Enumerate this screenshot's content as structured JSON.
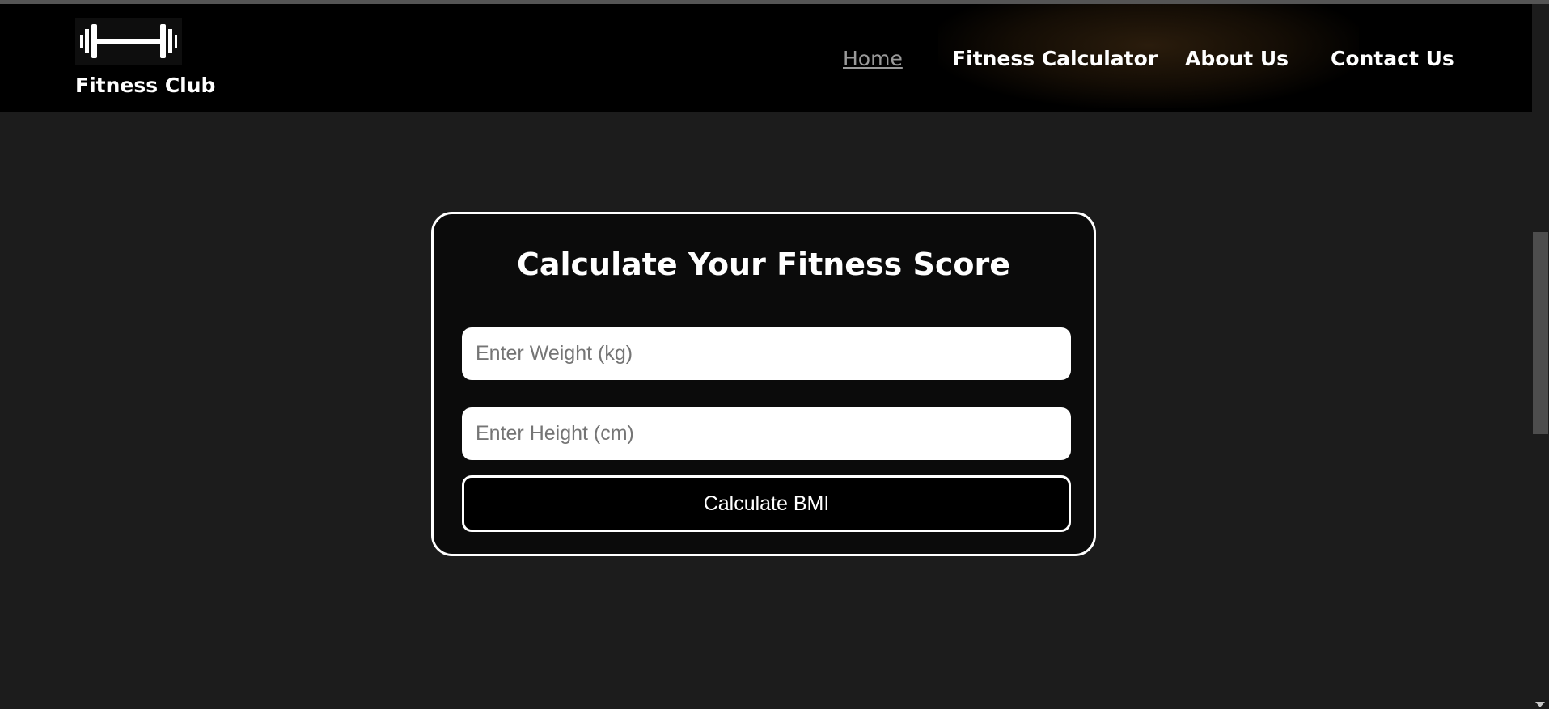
{
  "brand": {
    "logo_icon": "dumbbell-icon",
    "name": "Fitness Club"
  },
  "nav": {
    "items": [
      {
        "label": "Home",
        "active": true
      },
      {
        "label": "Fitness Calculator",
        "active": false
      },
      {
        "label": "About Us",
        "active": false
      },
      {
        "label": "Contact Us",
        "active": false
      }
    ]
  },
  "calculator": {
    "title": "Calculate Your Fitness Score",
    "weight_placeholder": "Enter Weight (kg)",
    "weight_value": "",
    "height_placeholder": "Enter Height (cm)",
    "height_value": "",
    "button_label": "Calculate BMI"
  },
  "colors": {
    "page_background": "#1c1c1c",
    "navbar_background": "#000000",
    "card_background": "#0b0b0b",
    "card_border": "#ffffff",
    "active_link": "#9a9a9a"
  },
  "scrollbar": {
    "icons": [
      "chevron-down-icon"
    ]
  }
}
